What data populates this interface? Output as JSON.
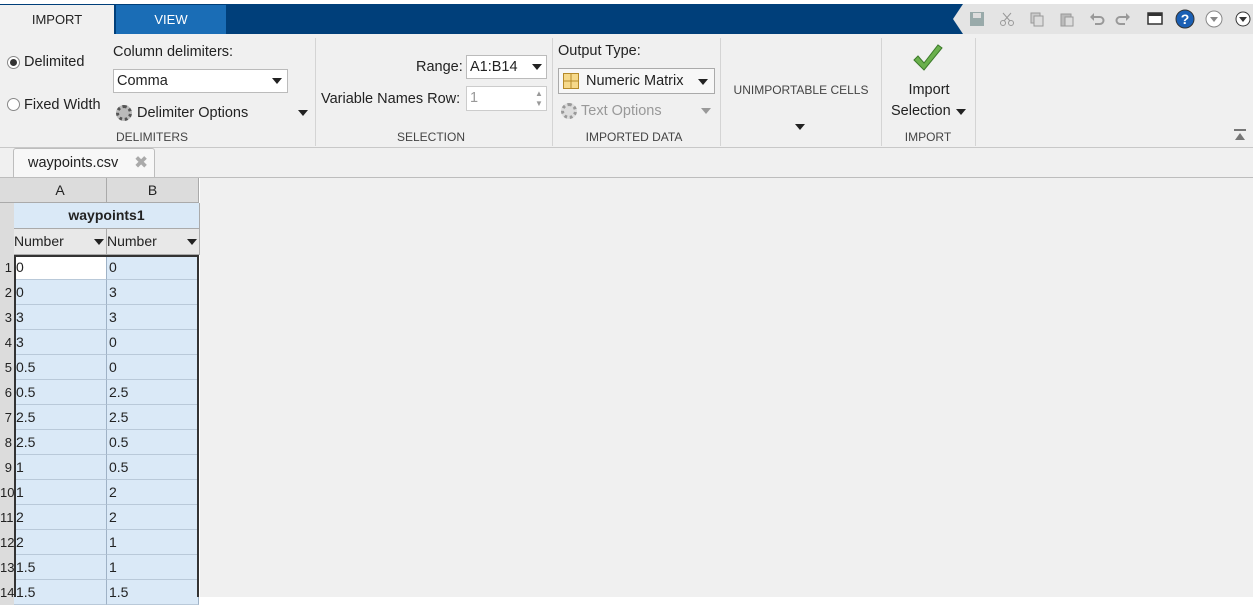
{
  "tabs": [
    {
      "label": "IMPORT"
    },
    {
      "label": "VIEW"
    }
  ],
  "toolbar_icons": [
    "save-icon",
    "cut-icon",
    "copy-icon",
    "paste-icon",
    "undo-icon",
    "redo-icon",
    "switch-windows-icon",
    "help-icon",
    "expand-icon"
  ],
  "delimiters": {
    "delimited_label": "Delimited",
    "fixed_width_label": "Fixed Width",
    "column_delimiters_label": "Column delimiters:",
    "column_delimiter_value": "Comma",
    "delimiter_options_label": "Delimiter Options",
    "section_label": "DELIMITERS"
  },
  "selection": {
    "range_label": "Range:",
    "range_value": "A1:B14",
    "varnames_label": "Variable Names Row:",
    "varnames_value": "1",
    "section_label": "SELECTION"
  },
  "imported_data": {
    "output_type_label": "Output Type:",
    "output_type_value": "Numeric Matrix",
    "text_options_label": "Text Options",
    "section_label": "IMPORTED DATA"
  },
  "unimportable": {
    "label": "UNIMPORTABLE CELLS"
  },
  "import": {
    "button_line1": "Import",
    "button_line2": "Selection",
    "section_label": "IMPORT"
  },
  "document": {
    "tab_label": "waypoints.csv"
  },
  "sheet": {
    "column_letters": [
      "A",
      "B"
    ],
    "variable_name": "waypoints1",
    "column_types": [
      "Number",
      "Number"
    ],
    "rows": [
      [
        "0",
        "0"
      ],
      [
        "0",
        "3"
      ],
      [
        "3",
        "3"
      ],
      [
        "3",
        "0"
      ],
      [
        "0.5",
        "0"
      ],
      [
        "0.5",
        "2.5"
      ],
      [
        "2.5",
        "2.5"
      ],
      [
        "2.5",
        "0.5"
      ],
      [
        "1",
        "0.5"
      ],
      [
        "1",
        "2"
      ],
      [
        "2",
        "2"
      ],
      [
        "2",
        "1"
      ],
      [
        "1.5",
        "1"
      ],
      [
        "1.5",
        "1.5"
      ]
    ]
  }
}
